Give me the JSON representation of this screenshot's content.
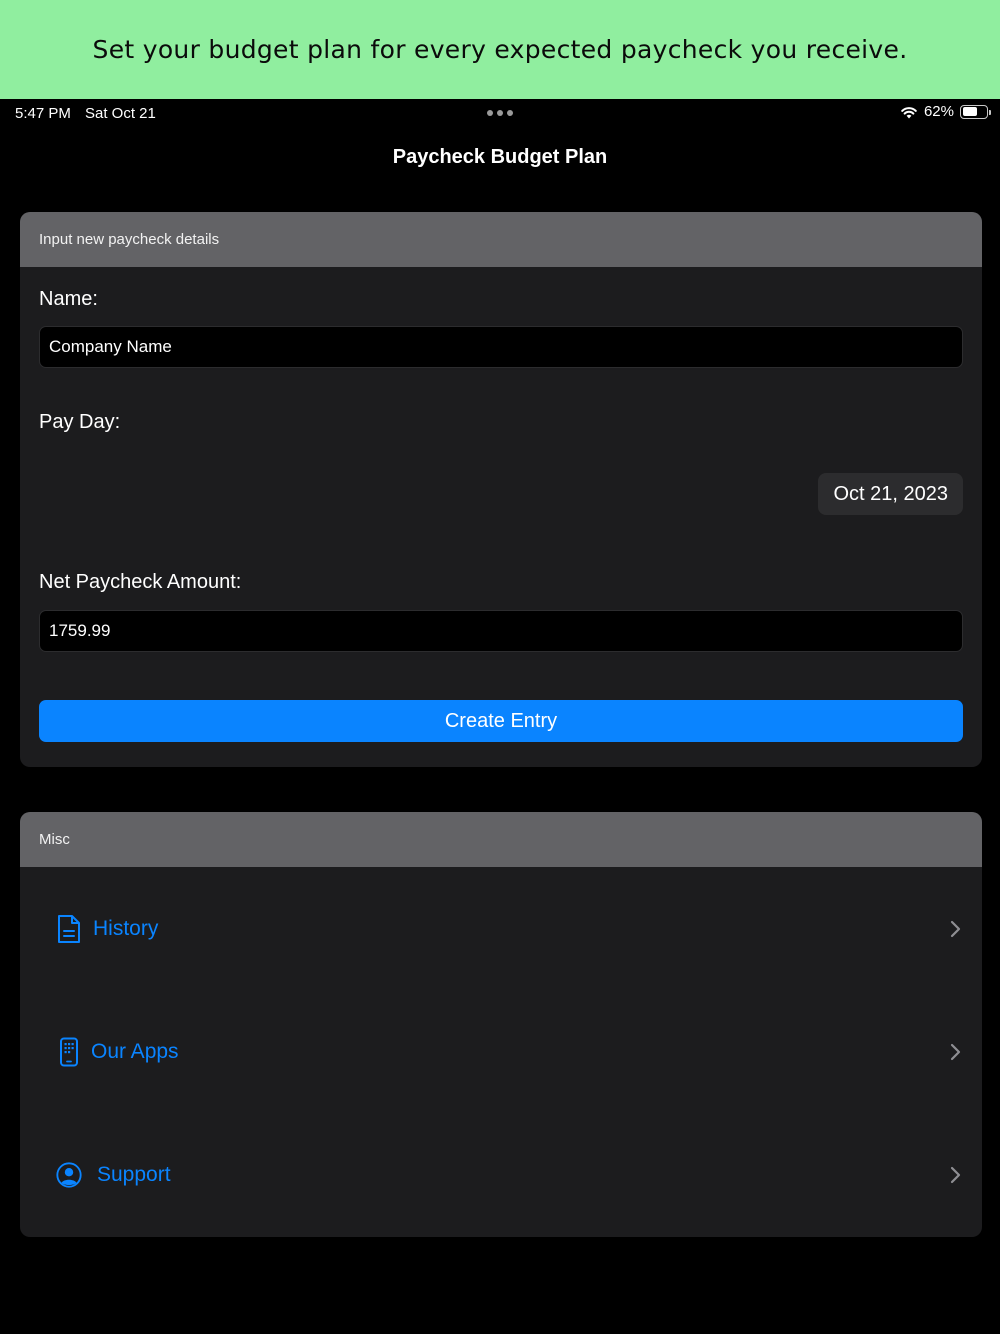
{
  "banner": {
    "text": "Set your budget plan for every expected paycheck you receive."
  },
  "status_bar": {
    "time": "5:47 PM",
    "date": "Sat Oct 21",
    "battery_percent": "62%",
    "battery_level": 0.62
  },
  "nav": {
    "title": "Paycheck Budget Plan"
  },
  "input_section": {
    "header": "Input new paycheck details",
    "name_label": "Name:",
    "name_value": "Company Name",
    "payday_label": "Pay Day:",
    "payday_value": "Oct 21, 2023",
    "amount_label": "Net Paycheck Amount:",
    "amount_value": "1759.99",
    "create_button": "Create Entry"
  },
  "misc_section": {
    "header": "Misc",
    "items": [
      {
        "label": "History",
        "icon": "document-icon"
      },
      {
        "label": "Our Apps",
        "icon": "phone-apps-icon"
      },
      {
        "label": "Support",
        "icon": "person-circle-icon"
      }
    ]
  },
  "colors": {
    "accent": "#0a84ff",
    "banner": "#90ee9f",
    "card": "#1c1c1e",
    "card_header": "#636366"
  }
}
